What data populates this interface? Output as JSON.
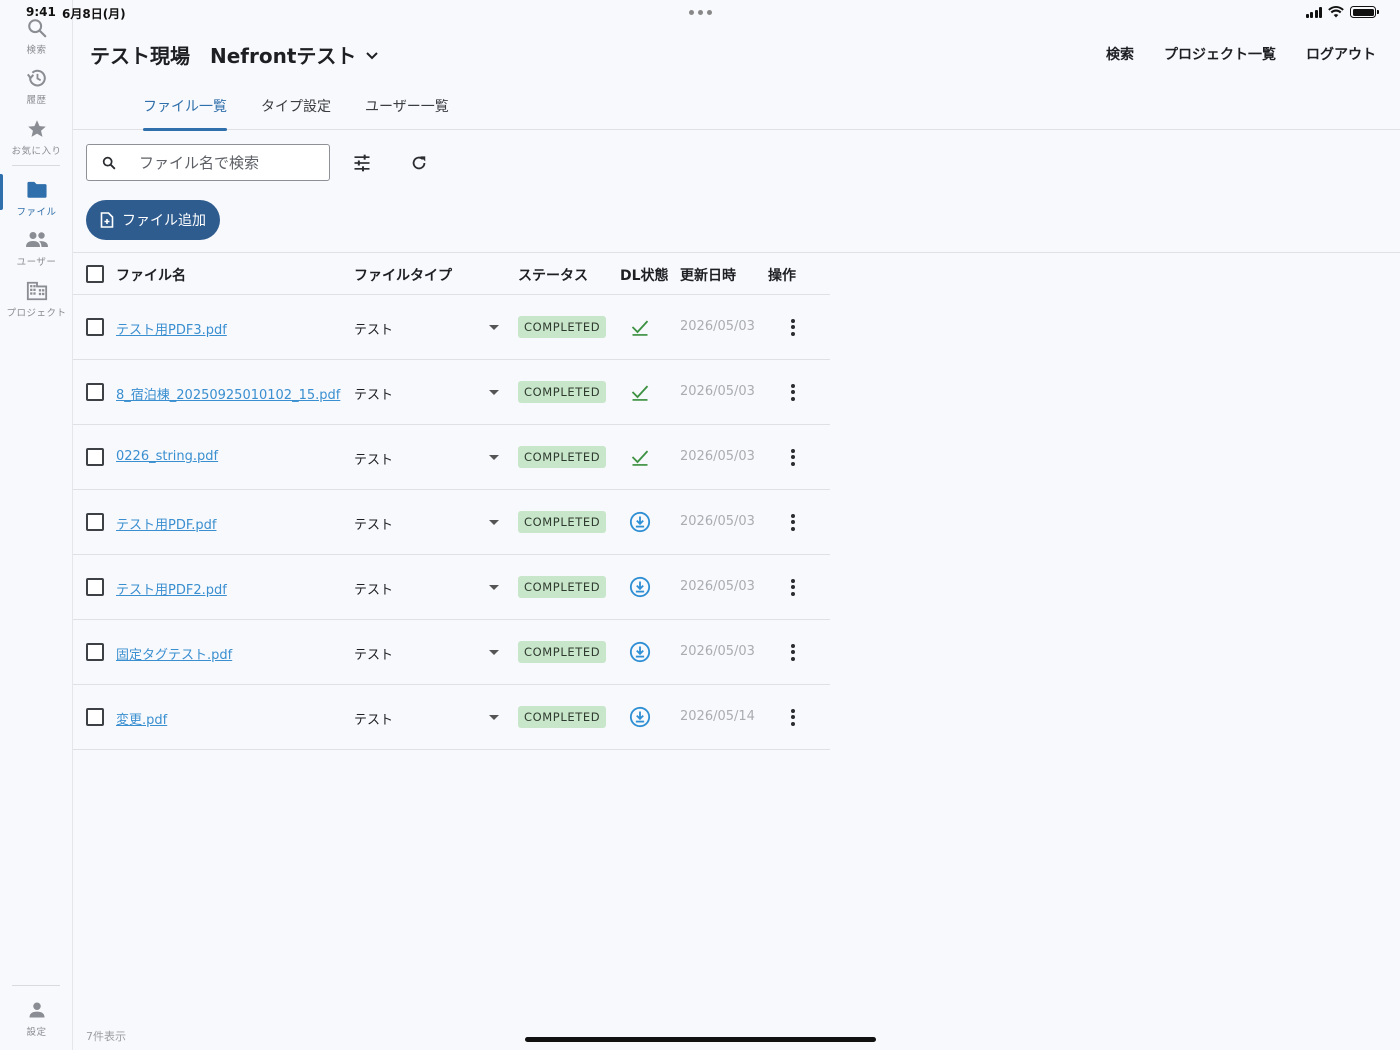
{
  "status": {
    "time": "9:41",
    "date": "6月8日(月)"
  },
  "sidebar": {
    "items": [
      {
        "label": "検索",
        "icon": "search-icon"
      },
      {
        "label": "履歴",
        "icon": "history-icon"
      },
      {
        "label": "お気に入り",
        "icon": "star-icon"
      },
      {
        "label": "ファイル",
        "icon": "folder-icon",
        "active": true
      },
      {
        "label": "ユーザー",
        "icon": "people-icon"
      },
      {
        "label": "プロジェクト",
        "icon": "building-icon"
      }
    ],
    "settings": {
      "label": "設定",
      "icon": "person-icon"
    }
  },
  "header": {
    "site": "テスト現場",
    "project": "Nefrontテスト",
    "nav": {
      "search": "検索",
      "projects": "プロジェクト一覧",
      "logout": "ログアウト"
    }
  },
  "tabs": [
    {
      "label": "ファイル一覧",
      "active": true
    },
    {
      "label": "タイプ設定"
    },
    {
      "label": "ユーザー一覧"
    }
  ],
  "toolbar": {
    "search_placeholder": "ファイル名で検索",
    "add_label": "ファイル追加"
  },
  "table": {
    "headers": {
      "name": "ファイル名",
      "type": "ファイルタイプ",
      "status": "ステータス",
      "dl": "DL状態",
      "updated": "更新日時",
      "actions": "操作"
    },
    "rows": [
      {
        "name": "テスト用PDF3.pdf",
        "type": "テスト",
        "status": "COMPLETED",
        "dl": "downloaded",
        "updated": "2026/05/03"
      },
      {
        "name": "8_宿泊棟_20250925010102_15.pdf",
        "type": "テスト",
        "status": "COMPLETED",
        "dl": "downloaded",
        "updated": "2026/05/03"
      },
      {
        "name": "0226_string.pdf",
        "type": "テスト",
        "status": "COMPLETED",
        "dl": "downloaded",
        "updated": "2026/05/03"
      },
      {
        "name": "テスト用PDF.pdf",
        "type": "テスト",
        "status": "COMPLETED",
        "dl": "download",
        "updated": "2026/05/03"
      },
      {
        "name": "テスト用PDF2.pdf",
        "type": "テスト",
        "status": "COMPLETED",
        "dl": "download",
        "updated": "2026/05/03"
      },
      {
        "name": "固定タグテスト.pdf",
        "type": "テスト",
        "status": "COMPLETED",
        "dl": "download",
        "updated": "2026/05/03"
      },
      {
        "name": "変更.pdf",
        "type": "テスト",
        "status": "COMPLETED",
        "dl": "download",
        "updated": "2026/05/14"
      }
    ]
  },
  "footer": {
    "count": "7件表示"
  },
  "colors": {
    "accent": "#2f6fab",
    "button": "#2f5c8f",
    "link": "#3a8fd0",
    "badge": "#c8e6c9",
    "check": "#3d9142"
  }
}
